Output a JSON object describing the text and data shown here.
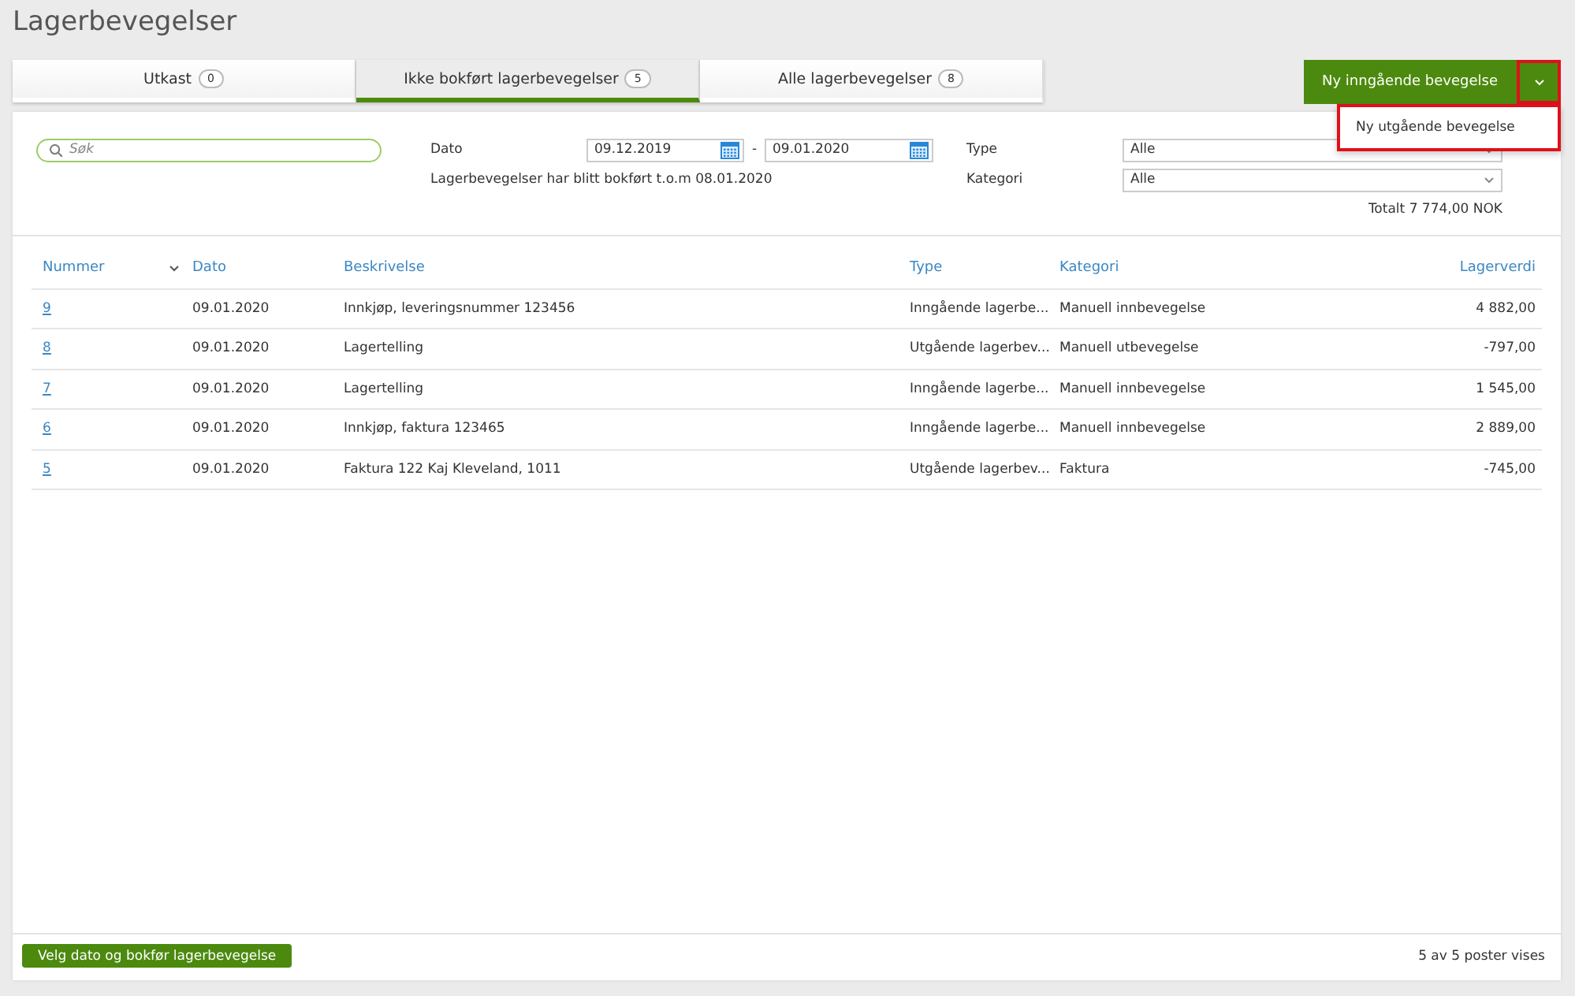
{
  "page_title": "Lagerbevegelser",
  "tabs": [
    {
      "label": "Utkast",
      "count": "0",
      "selected": false
    },
    {
      "label": "Ikke bokført lagerbevegelser",
      "count": "5",
      "selected": true
    },
    {
      "label": "Alle lagerbevegelser",
      "count": "8",
      "selected": false
    }
  ],
  "new_button": {
    "label": "Ny inngående bevegelse",
    "menu": {
      "expanded": true,
      "items": [
        "Ny utgående bevegelse"
      ]
    }
  },
  "filters": {
    "search": {
      "placeholder": "Søk"
    },
    "date_label": "Dato",
    "date_from": "09.12.2019",
    "date_separator": "-",
    "date_to": "09.01.2020",
    "posted_note": "Lagerbevegelser har blitt bokført t.o.m 08.01.2020",
    "type_label": "Type",
    "type_value": "Alle",
    "category_label": "Kategori",
    "category_value": "Alle",
    "total": "Totalt 7 774,00 NOK"
  },
  "table": {
    "columns": [
      "Nummer",
      "Dato",
      "Beskrivelse",
      "Type",
      "Kategori",
      "Lagerverdi"
    ],
    "rows": [
      {
        "number": "9",
        "date": "09.01.2020",
        "description": "Innkjøp, leveringsnummer 123456",
        "type": "Inngående lagerbe...",
        "category": "Manuell innbevegelse",
        "value": "4 882,00"
      },
      {
        "number": "8",
        "date": "09.01.2020",
        "description": "Lagertelling",
        "type": "Utgående lagerbev...",
        "category": "Manuell utbevegelse",
        "value": "-797,00"
      },
      {
        "number": "7",
        "date": "09.01.2020",
        "description": "Lagertelling",
        "type": "Inngående lagerbe...",
        "category": "Manuell innbevegelse",
        "value": "1 545,00"
      },
      {
        "number": "6",
        "date": "09.01.2020",
        "description": "Innkjøp, faktura 123465",
        "type": "Inngående lagerbe...",
        "category": "Manuell innbevegelse",
        "value": "2 889,00"
      },
      {
        "number": "5",
        "date": "09.01.2020",
        "description": "Faktura 122 Kaj Kleveland, 1011",
        "type": "Utgående lagerbev...",
        "category": "Faktura",
        "value": "-745,00"
      }
    ]
  },
  "footer": {
    "button": "Velg dato og bokfør lagerbevegelse",
    "count_text": "5 av 5 poster vises"
  }
}
